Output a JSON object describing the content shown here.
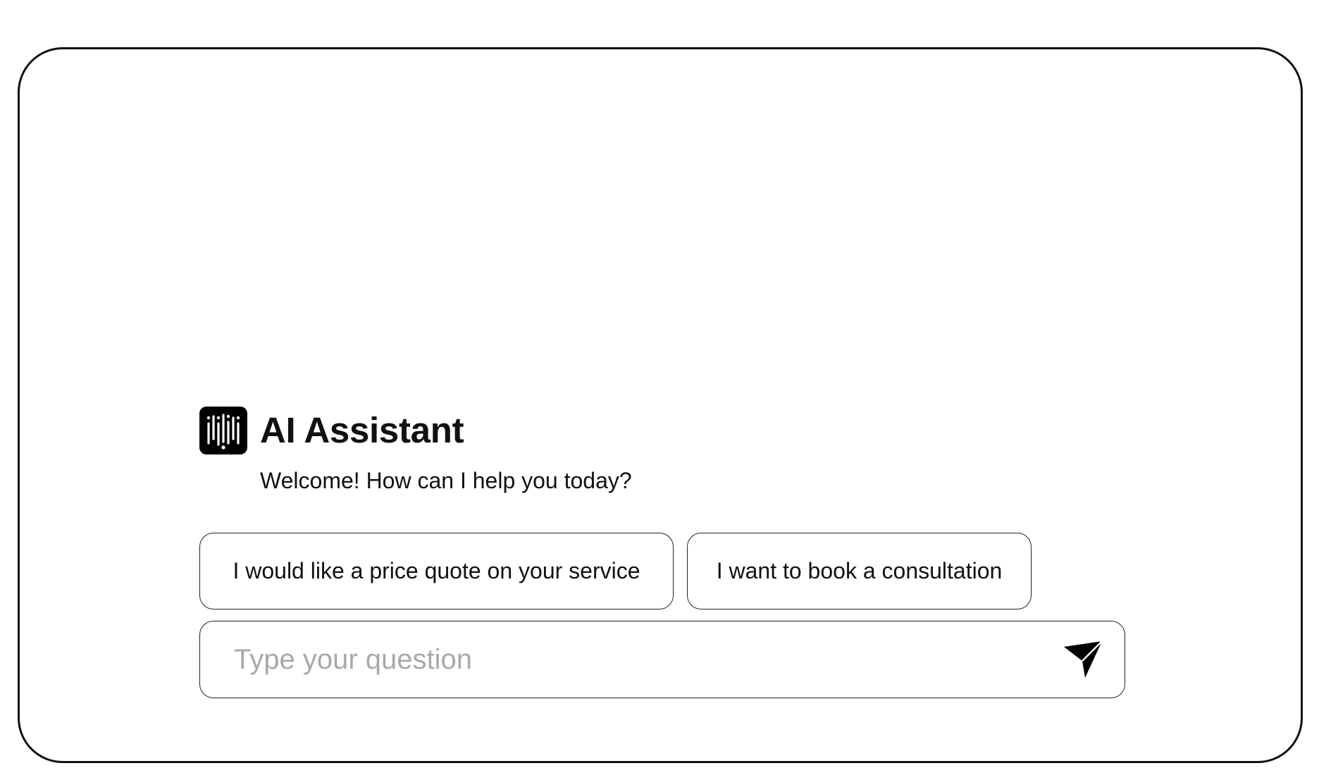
{
  "assistant": {
    "title": "AI Assistant",
    "welcome": "Welcome! How can I help you today?",
    "logo_icon": "audio-bars-icon"
  },
  "suggestions": [
    {
      "label": "I would like a price quote on your service"
    },
    {
      "label": "I want to book a consultation"
    }
  ],
  "composer": {
    "placeholder": "Type your question",
    "value": "",
    "send_icon": "send-icon"
  },
  "colors": {
    "border": "#111111",
    "text": "#111111",
    "placeholder": "#a9a9a9",
    "background": "#ffffff"
  }
}
